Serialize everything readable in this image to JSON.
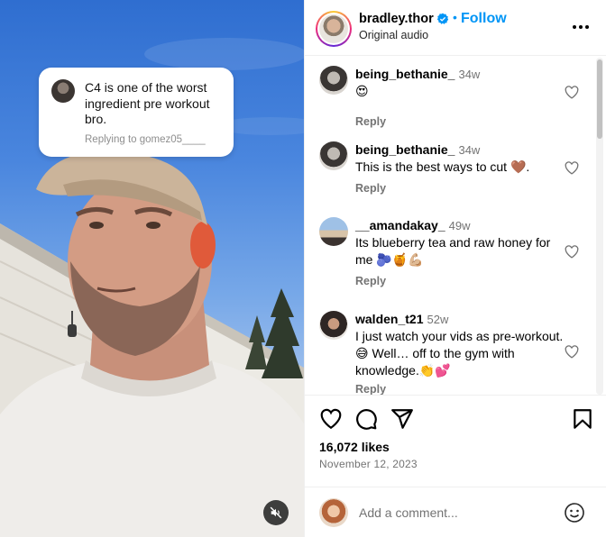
{
  "reply_sticker": {
    "text": "C4 is one of the worst ingredient pre workout bro.",
    "replying_to": "Replying to gomez05____"
  },
  "post": {
    "username": "bradley.thor",
    "separator": "•",
    "follow_label": "Follow",
    "audio": "Original audio"
  },
  "comments": [
    {
      "user": "being_bethanie_",
      "time": "34w",
      "text": "😍",
      "reply_label": "Reply"
    },
    {
      "user": "being_bethanie_",
      "time": "34w",
      "text": "This is the best ways to cut 🤎.",
      "reply_label": "Reply"
    },
    {
      "user": "__amandakay_",
      "time": "49w",
      "text": "Its blueberry tea and raw honey for me 🫐🍯💪🏼",
      "reply_label": "Reply"
    },
    {
      "user": "walden_t21",
      "time": "52w",
      "text": "I just watch your vids as pre-workout.😅 Well… off to the gym with knowledge.👏💕",
      "reply_label": "Reply"
    }
  ],
  "stats": {
    "likes": "16,072 likes",
    "date": "November 12, 2023"
  },
  "composer": {
    "placeholder": "Add a comment..."
  },
  "icons": [
    "verified-badge-icon",
    "more-options-icon",
    "heart-icon",
    "comment-icon",
    "share-icon",
    "bookmark-icon",
    "emoji-icon",
    "muted-speaker-icon"
  ],
  "colors": {
    "accent": "#0095f6",
    "secondary_text": "#737373",
    "border": "#efefef"
  }
}
